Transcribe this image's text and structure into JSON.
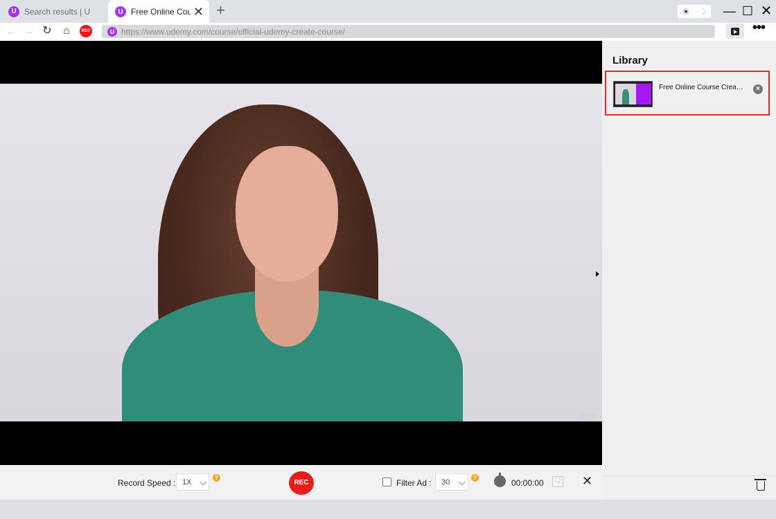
{
  "tabs": [
    {
      "label": "Search results | U",
      "favicon": "udemy-logo",
      "active": false
    },
    {
      "label": "Free Online Cour",
      "favicon": "udemy-logo",
      "active": true
    }
  ],
  "favicon_glyph": "U",
  "icons": {
    "new_tab": "+",
    "sun": "☀",
    "moon": "☽",
    "minimize": "—",
    "maximize": "☐",
    "close": "✕",
    "back": "←",
    "forward": "→",
    "reload": "↻",
    "home": "⌂",
    "more": "•••",
    "chevron": "⌵",
    "help": "?",
    "stop": "→",
    "remove": "×"
  },
  "toolbar": {
    "rec_badge": "REC",
    "url": "https://www.udemy.com/course/official-udemy-create-course/"
  },
  "video": {
    "watermark": "Udemy"
  },
  "controls": {
    "record_speed_label": "Record Speed :",
    "record_speed_value": "1X",
    "rec_button": "REC",
    "filter_ad_label": "Filter Ad :",
    "filter_ad_checked": false,
    "filter_ad_value": "30",
    "timer": "00:00:00"
  },
  "library": {
    "title": "Library",
    "items": [
      {
        "title": "Free Online Course Creati..."
      }
    ]
  },
  "colors": {
    "accent_red": "#e8151b",
    "udemy_purple": "#a435f0",
    "highlight_border": "#e52a2a",
    "help_orange": "#f5a623"
  }
}
